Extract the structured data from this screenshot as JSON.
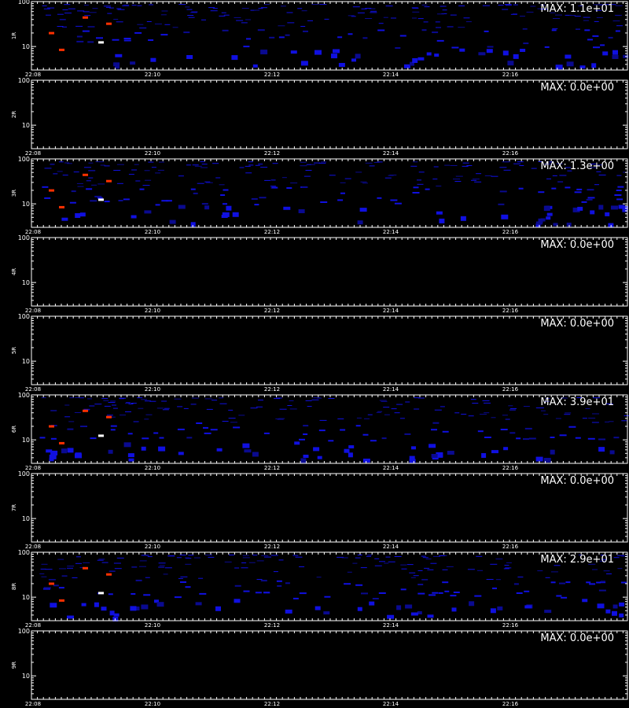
{
  "chart_data": [
    {
      "type": "heatmap",
      "panel": "1R",
      "ylabel": "1R",
      "max_label": "MAX: 1.1e+01",
      "has_data": true,
      "x_ticks": [
        "22:08",
        "22:10",
        "22:12",
        "22:14",
        "22:16"
      ],
      "y_ticks": [
        "100",
        "10"
      ]
    },
    {
      "type": "heatmap",
      "panel": "2R",
      "ylabel": "2R",
      "max_label": "MAX: 0.0e+00",
      "has_data": false,
      "x_ticks": [
        "22:08",
        "22:10",
        "22:12",
        "22:14",
        "22:16"
      ],
      "y_ticks": [
        "100",
        "10"
      ]
    },
    {
      "type": "heatmap",
      "panel": "3R",
      "ylabel": "3R",
      "max_label": "MAX: 1.3e+00",
      "has_data": true,
      "x_ticks": [
        "22:08",
        "22:10",
        "22:12",
        "22:14",
        "22:16"
      ],
      "y_ticks": [
        "100",
        "10"
      ]
    },
    {
      "type": "heatmap",
      "panel": "4R",
      "ylabel": "4R",
      "max_label": "MAX: 0.0e+00",
      "has_data": false,
      "x_ticks": [
        "22:08",
        "22:10",
        "22:12",
        "22:14",
        "22:16"
      ],
      "y_ticks": [
        "100",
        "10"
      ]
    },
    {
      "type": "heatmap",
      "panel": "5R",
      "ylabel": "5R",
      "max_label": "MAX: 0.0e+00",
      "has_data": false,
      "x_ticks": [
        "22:08",
        "22:10",
        "22:12",
        "22:14",
        "22:16"
      ],
      "y_ticks": [
        "100",
        "10"
      ]
    },
    {
      "type": "heatmap",
      "panel": "6R",
      "ylabel": "6R",
      "max_label": "MAX: 3.9e+01",
      "has_data": true,
      "x_ticks": [
        "22:08",
        "22:10",
        "22:12",
        "22:14",
        "22:16"
      ],
      "y_ticks": [
        "100",
        "10"
      ]
    },
    {
      "type": "heatmap",
      "panel": "7R",
      "ylabel": "7R",
      "max_label": "MAX: 0.0e+00",
      "has_data": false,
      "x_ticks": [
        "22:08",
        "22:10",
        "22:12",
        "22:14",
        "22:16"
      ],
      "y_ticks": [
        "100",
        "10"
      ]
    },
    {
      "type": "heatmap",
      "panel": "8R",
      "ylabel": "8R",
      "max_label": "MAX: 2.9e+01",
      "has_data": true,
      "x_ticks": [
        "22:08",
        "22:10",
        "22:12",
        "22:14",
        "22:16"
      ],
      "y_ticks": [
        "100",
        "10"
      ]
    },
    {
      "type": "heatmap",
      "panel": "9R",
      "ylabel": "9R",
      "max_label": "MAX: 0.0e+00",
      "has_data": false,
      "x_ticks": [
        "22:08",
        "22:10",
        "22:12",
        "22:14",
        "22:16"
      ],
      "y_ticks": [
        "100",
        "10"
      ]
    }
  ],
  "colors": {
    "background": "#000000",
    "axis": "#ffffff",
    "low": "#1010e0",
    "dim": "#0a0a90",
    "high": "#ff3000",
    "peak": "#ffffff"
  }
}
